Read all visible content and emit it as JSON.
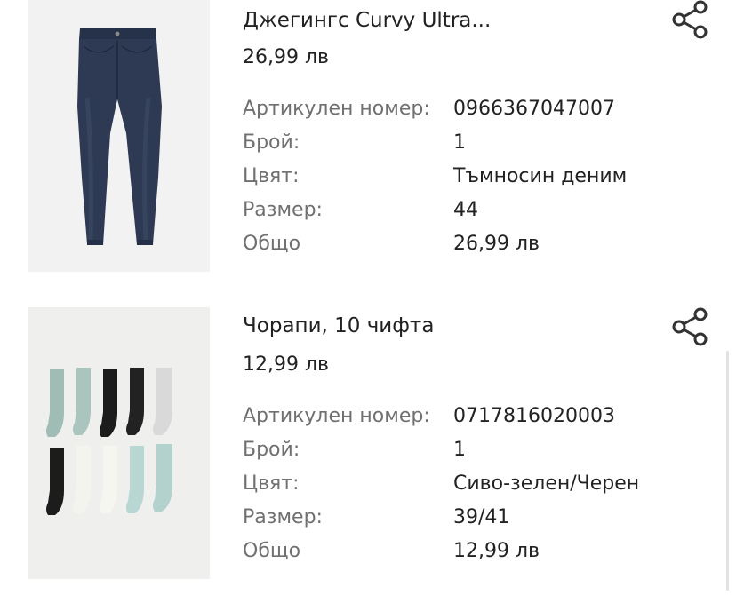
{
  "cart": {
    "items": [
      {
        "title": "Джегингс Curvy Ultra...",
        "price": "26,99 лв",
        "image_icon": "jeans-product-image",
        "details": [
          {
            "label": "Артикулен номер:",
            "value": "0966367047007"
          },
          {
            "label": "Брой:",
            "value": "1"
          },
          {
            "label": "Цвят:",
            "value": "Тъмносин деним"
          },
          {
            "label": "Размер:",
            "value": "44"
          },
          {
            "label": "Общо",
            "value": "26,99 лв"
          }
        ]
      },
      {
        "title": "Чорапи, 10 чифта",
        "price": "12,99 лв",
        "image_icon": "socks-product-image",
        "details": [
          {
            "label": "Артикулен номер:",
            "value": "0717816020003"
          },
          {
            "label": "Брой:",
            "value": "1"
          },
          {
            "label": "Цвят:",
            "value": "Сиво-зелен/Черен"
          },
          {
            "label": "Размер:",
            "value": "39/41"
          },
          {
            "label": "Общо",
            "value": "12,99 лв"
          }
        ]
      }
    ]
  },
  "icons": {
    "share": "share-icon"
  },
  "colors": {
    "label": "#707070",
    "text": "#222222",
    "thumb_bg": "#f1f1f1",
    "denim": "#2c3850",
    "sock_sage": "#9fbdb5",
    "sock_black": "#1c1c1c",
    "sock_white": "#f4f4ee",
    "sock_grey": "#d9d9d9",
    "sock_mint": "#b8d6d2"
  }
}
